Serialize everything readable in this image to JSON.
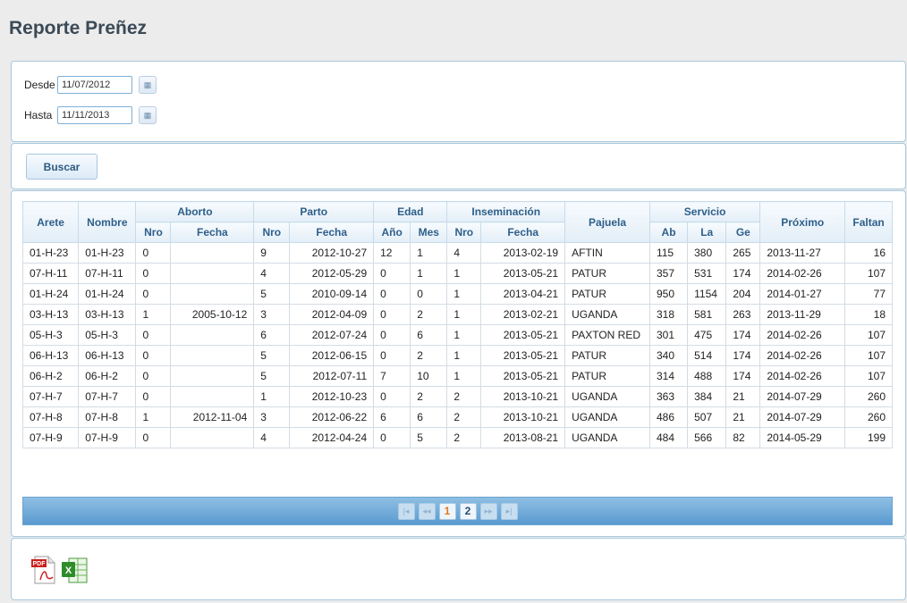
{
  "page_title": "Reporte Preñez",
  "filters": {
    "desde_label": "Desde",
    "desde_value": "11/07/2012",
    "hasta_label": "Hasta",
    "hasta_value": "11/11/2013"
  },
  "search_button": "Buscar",
  "table": {
    "headers": {
      "arete": "Arete",
      "nombre": "Nombre",
      "aborto": "Aborto",
      "parto": "Parto",
      "edad": "Edad",
      "inseminacion": "Inseminación",
      "pajuela": "Pajuela",
      "servicio": "Servicio",
      "proximo": "Próximo",
      "faltan": "Faltan",
      "sub": {
        "aborto_nro": "Nro",
        "aborto_fecha": "Fecha",
        "parto_nro": "Nro",
        "parto_fecha": "Fecha",
        "edad_ano": "Año",
        "edad_mes": "Mes",
        "ins_nro": "Nro",
        "ins_fecha": "Fecha",
        "serv_ab": "Ab",
        "serv_la": "La",
        "serv_ge": "Ge"
      }
    },
    "rows": [
      [
        "01-H-23",
        "01-H-23",
        "0",
        "",
        "9",
        "2012-10-27",
        "12",
        "1",
        "4",
        "2013-02-19",
        "AFTIN",
        "115",
        "380",
        "265",
        "2013-11-27",
        "16"
      ],
      [
        "07-H-11",
        "07-H-11",
        "0",
        "",
        "4",
        "2012-05-29",
        "0",
        "1",
        "1",
        "2013-05-21",
        "PATUR",
        "357",
        "531",
        "174",
        "2014-02-26",
        "107"
      ],
      [
        "01-H-24",
        "01-H-24",
        "0",
        "",
        "5",
        "2010-09-14",
        "0",
        "0",
        "1",
        "2013-04-21",
        "PATUR",
        "950",
        "1154",
        "204",
        "2014-01-27",
        "77"
      ],
      [
        "03-H-13",
        "03-H-13",
        "1",
        "2005-10-12",
        "3",
        "2012-04-09",
        "0",
        "2",
        "1",
        "2013-02-21",
        "UGANDA",
        "318",
        "581",
        "263",
        "2013-11-29",
        "18"
      ],
      [
        "05-H-3",
        "05-H-3",
        "0",
        "",
        "6",
        "2012-07-24",
        "0",
        "6",
        "1",
        "2013-05-21",
        "PAXTON RED",
        "301",
        "475",
        "174",
        "2014-02-26",
        "107"
      ],
      [
        "06-H-13",
        "06-H-13",
        "0",
        "",
        "5",
        "2012-06-15",
        "0",
        "2",
        "1",
        "2013-05-21",
        "PATUR",
        "340",
        "514",
        "174",
        "2014-02-26",
        "107"
      ],
      [
        "06-H-2",
        "06-H-2",
        "0",
        "",
        "5",
        "2012-07-11",
        "7",
        "10",
        "1",
        "2013-05-21",
        "PATUR",
        "314",
        "488",
        "174",
        "2014-02-26",
        "107"
      ],
      [
        "07-H-7",
        "07-H-7",
        "0",
        "",
        "1",
        "2012-10-23",
        "0",
        "2",
        "2",
        "2013-10-21",
        "UGANDA",
        "363",
        "384",
        "21",
        "2014-07-29",
        "260"
      ],
      [
        "07-H-8",
        "07-H-8",
        "1",
        "2012-11-04",
        "3",
        "2012-06-22",
        "6",
        "6",
        "2",
        "2013-10-21",
        "UGANDA",
        "486",
        "507",
        "21",
        "2014-07-29",
        "260"
      ],
      [
        "07-H-9",
        "07-H-9",
        "0",
        "",
        "4",
        "2012-04-24",
        "0",
        "5",
        "2",
        "2013-08-21",
        "UGANDA",
        "484",
        "566",
        "82",
        "2014-05-29",
        "199"
      ]
    ]
  },
  "pager": {
    "first": "|◂",
    "prev": "◂◂",
    "pages": [
      "1",
      "2"
    ],
    "active_page": "1",
    "next": "▸▸",
    "last": "▸|"
  },
  "export": {
    "pdf_icon": "pdf-icon",
    "pdf_badge": "PDF",
    "excel_icon": "excel-icon",
    "excel_badge": "X"
  }
}
